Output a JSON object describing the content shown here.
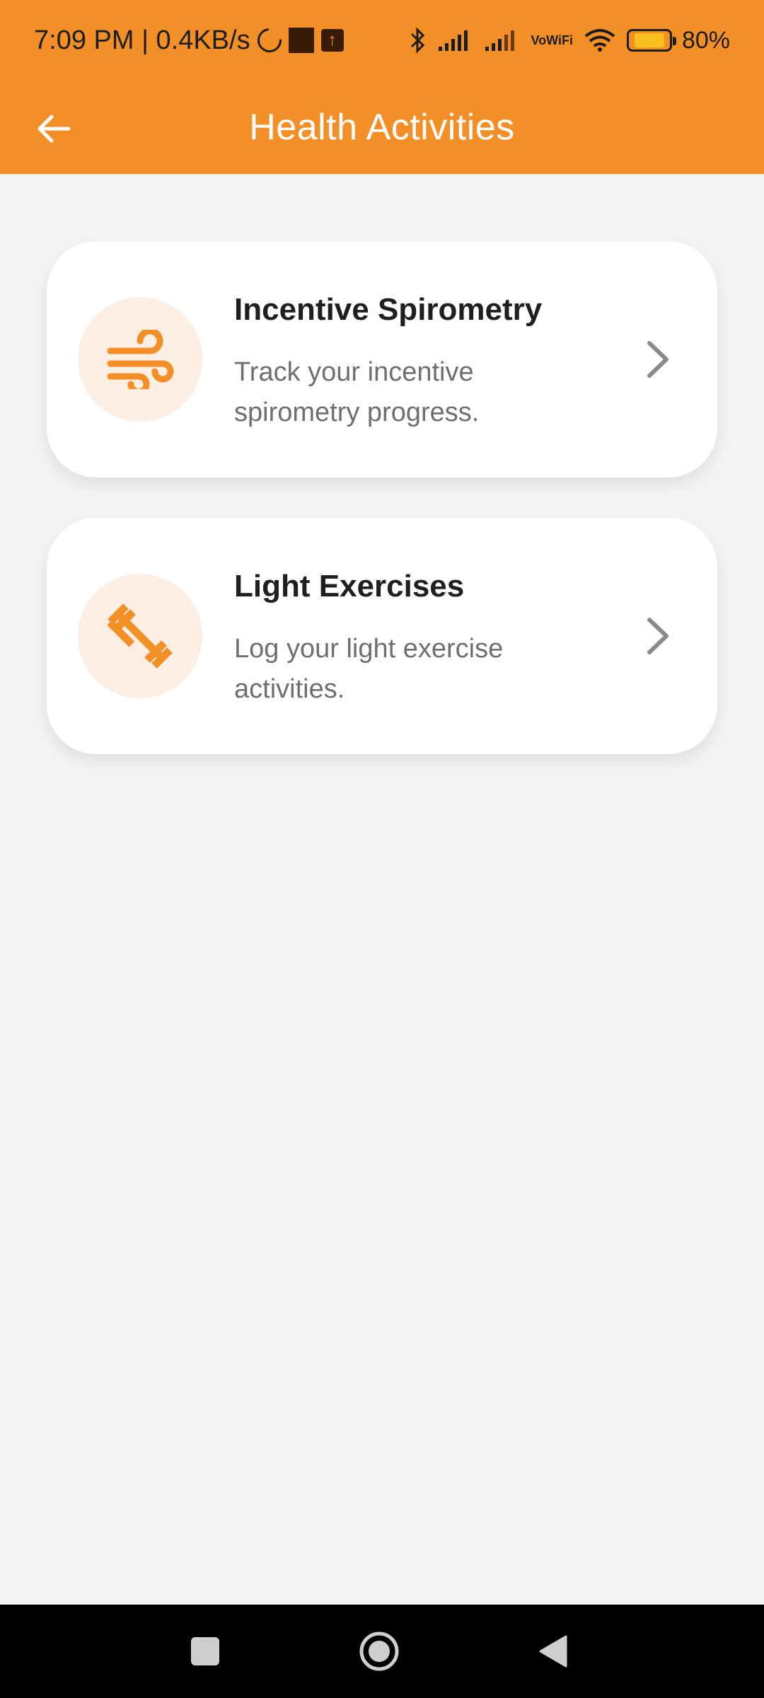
{
  "status_bar": {
    "time_speed": "7:09 PM | 0.4KB/s",
    "vowifi_line1": "Vo",
    "vowifi_line2": "WiFi",
    "battery": "80%",
    "battery_level": 0.8
  },
  "app_bar": {
    "title": "Health Activities",
    "accent_color": "#f28f27"
  },
  "activities": [
    {
      "title": "Incentive Spirometry",
      "description": "Track your incentive spirometry progress.",
      "icon": "wind-icon"
    },
    {
      "title": "Light Exercises",
      "description": "Log your light exercise activities.",
      "icon": "dumbbell-icon"
    }
  ],
  "colors": {
    "icon_orange": "#f28f27",
    "icon_circle_bg": "#fdeee3",
    "background": "#f4f4f4"
  }
}
